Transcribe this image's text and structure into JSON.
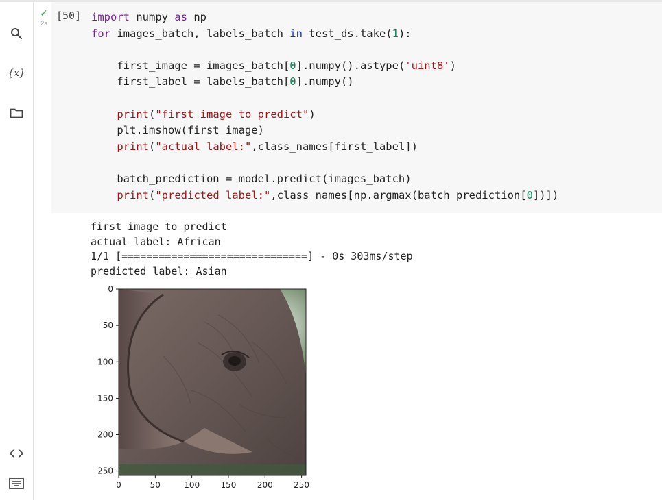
{
  "sidebar": {
    "search_icon": "search-icon",
    "variables_label": "{x}",
    "files_icon": "folder-icon",
    "snippets_icon": "code-icon",
    "terminal_icon": "keyboard-icon"
  },
  "cell": {
    "status_icon": "check-icon",
    "status_mark": "✓",
    "exec_time": "2s",
    "exec_count": "[50]",
    "code_lines": [
      "import numpy as np",
      "for images_batch, labels_batch in test_ds.take(1):",
      "",
      "    first_image = images_batch[0].numpy().astype('uint8')",
      "    first_label = labels_batch[0].numpy()",
      "",
      "    print(\"first image to predict\")",
      "    plt.imshow(first_image)",
      "    print(\"actual label:\",class_names[first_label])",
      "",
      "    batch_prediction = model.predict(images_batch)",
      "    print(\"predicted label:\",class_names[np.argmax(batch_prediction[0])])"
    ]
  },
  "output": {
    "lines": [
      "first image to predict",
      "actual label: African",
      "1/1 [==============================] - 0s 303ms/step",
      "predicted label: Asian"
    ]
  },
  "chart_data": {
    "type": "image",
    "content": "imshow of elephant head close-up",
    "x_ticks": [
      "0",
      "50",
      "100",
      "150",
      "200",
      "250"
    ],
    "y_ticks": [
      "0",
      "50",
      "100",
      "150",
      "200",
      "250"
    ],
    "xlim": [
      0,
      256
    ],
    "ylim": [
      256,
      0
    ]
  },
  "colors": {
    "accent_check": "#34a853",
    "keyword": "#7a1fa2",
    "string": "#a31515",
    "number": "#098658"
  }
}
